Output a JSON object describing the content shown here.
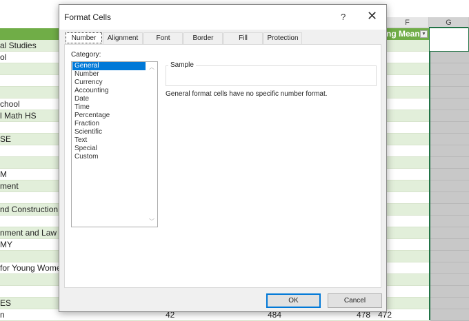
{
  "sheet": {
    "columns": [
      "F",
      "G"
    ],
    "header_f": "ng Mean",
    "rows": [
      {
        "text": "al Studies",
        "shade": "g"
      },
      {
        "text": "ol",
        "shade": "w"
      },
      {
        "text": "",
        "shade": "g"
      },
      {
        "text": "",
        "shade": "w"
      },
      {
        "text": "",
        "shade": "g"
      },
      {
        "text": "chool",
        "shade": "w"
      },
      {
        "text": "l Math HS",
        "shade": "g"
      },
      {
        "text": "",
        "shade": "w"
      },
      {
        "text": "SE",
        "shade": "g"
      },
      {
        "text": "",
        "shade": "w"
      },
      {
        "text": "",
        "shade": "g"
      },
      {
        "text": "M",
        "shade": "w"
      },
      {
        "text": "ment",
        "shade": "g"
      },
      {
        "text": "",
        "shade": "w"
      },
      {
        "text": "nd Construction",
        "shade": "g"
      },
      {
        "text": "",
        "shade": "w"
      },
      {
        "text": "nment and Law",
        "shade": "g"
      },
      {
        "text": "MY",
        "shade": "w"
      },
      {
        "text": "",
        "shade": "g"
      },
      {
        "text": "for Young Wome",
        "shade": "w"
      },
      {
        "text": "",
        "shade": "g"
      },
      {
        "text": "",
        "shade": "w"
      },
      {
        "text": "ES",
        "shade": "g"
      },
      {
        "text": "n",
        "shade": "w"
      }
    ],
    "last_row_values": [
      "42",
      "484",
      "478",
      "472"
    ]
  },
  "dialog": {
    "title": "Format Cells",
    "help": "?",
    "close": "✕",
    "tabs": [
      "Number",
      "Alignment",
      "Font",
      "Border",
      "Fill",
      "Protection"
    ],
    "active_tab": "Number",
    "category_label": "Category:",
    "categories": [
      "General",
      "Number",
      "Currency",
      "Accounting",
      "Date",
      "Time",
      "Percentage",
      "Fraction",
      "Scientific",
      "Text",
      "Special",
      "Custom"
    ],
    "selected_category": "General",
    "sample_label": "Sample",
    "description": "General format cells have no specific number format.",
    "ok": "OK",
    "cancel": "Cancel"
  }
}
